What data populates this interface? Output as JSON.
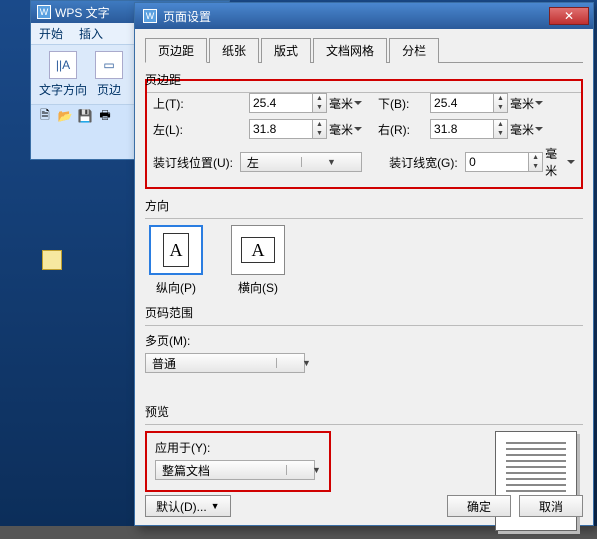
{
  "wps": {
    "title": "WPS 文字",
    "menu": {
      "start": "开始",
      "insert": "插入"
    },
    "ribbon": {
      "direction": "文字方向",
      "margins": "页边"
    }
  },
  "dialog": {
    "title": "页面设置",
    "tabs": [
      "页边距",
      "纸张",
      "版式",
      "文档网格",
      "分栏"
    ],
    "group_margins": "页边距",
    "margins": {
      "top_label": "上(T):",
      "top": "25.4",
      "bottom_label": "下(B):",
      "bottom": "25.4",
      "left_label": "左(L):",
      "left": "31.8",
      "right_label": "右(R):",
      "right": "31.8",
      "gutter_pos_label": "装订线位置(U):",
      "gutter_pos": "左",
      "gutter_width_label": "装订线宽(G):",
      "gutter_width": "0",
      "unit": "毫米"
    },
    "group_orient": "方向",
    "orient": {
      "portrait": "纵向(P)",
      "landscape": "横向(S)"
    },
    "group_range": "页码范围",
    "range": {
      "multi_label": "多页(M):",
      "multi": "普通"
    },
    "group_preview": "预览",
    "preview": {
      "apply_label": "应用于(Y):",
      "apply": "整篇文档"
    },
    "buttons": {
      "default": "默认(D)...",
      "ok": "确定",
      "cancel": "取消"
    }
  }
}
